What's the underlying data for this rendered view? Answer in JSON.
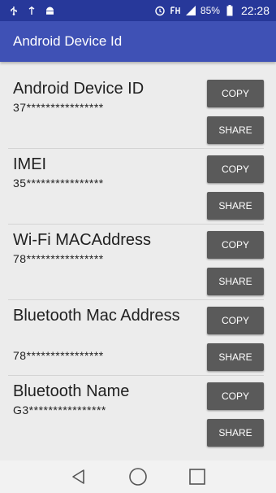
{
  "status_bar": {
    "battery": "85%",
    "time": "22:28",
    "icons_left": [
      "usb-icon",
      "android-debug-icon",
      "android-icon"
    ],
    "icons_right": [
      "alarm-icon",
      "signal-icon",
      "battery-icon"
    ]
  },
  "app_bar": {
    "title": "Android Device Id"
  },
  "items": [
    {
      "label": "Android Device ID",
      "value": "37****************",
      "copy": "COPY",
      "share": "SHARE"
    },
    {
      "label": "IMEI",
      "value": "35****************",
      "copy": "COPY",
      "share": "SHARE"
    },
    {
      "label": "Wi-Fi MACAddress",
      "value": "78****************",
      "copy": "COPY",
      "share": "SHARE"
    },
    {
      "label": "Bluetooth Mac Address",
      "value": "78****************",
      "copy": "COPY",
      "share": "SHARE"
    },
    {
      "label": "Bluetooth Name",
      "value": "G3****************",
      "copy": "COPY",
      "share": "SHARE"
    }
  ],
  "nav_bar": {
    "buttons": [
      "back-icon",
      "home-icon",
      "recents-icon"
    ]
  },
  "colors": {
    "status_bar": "#27389a",
    "app_bar": "#3f51b5",
    "button": "#5a5a5a",
    "background": "#ececec"
  }
}
